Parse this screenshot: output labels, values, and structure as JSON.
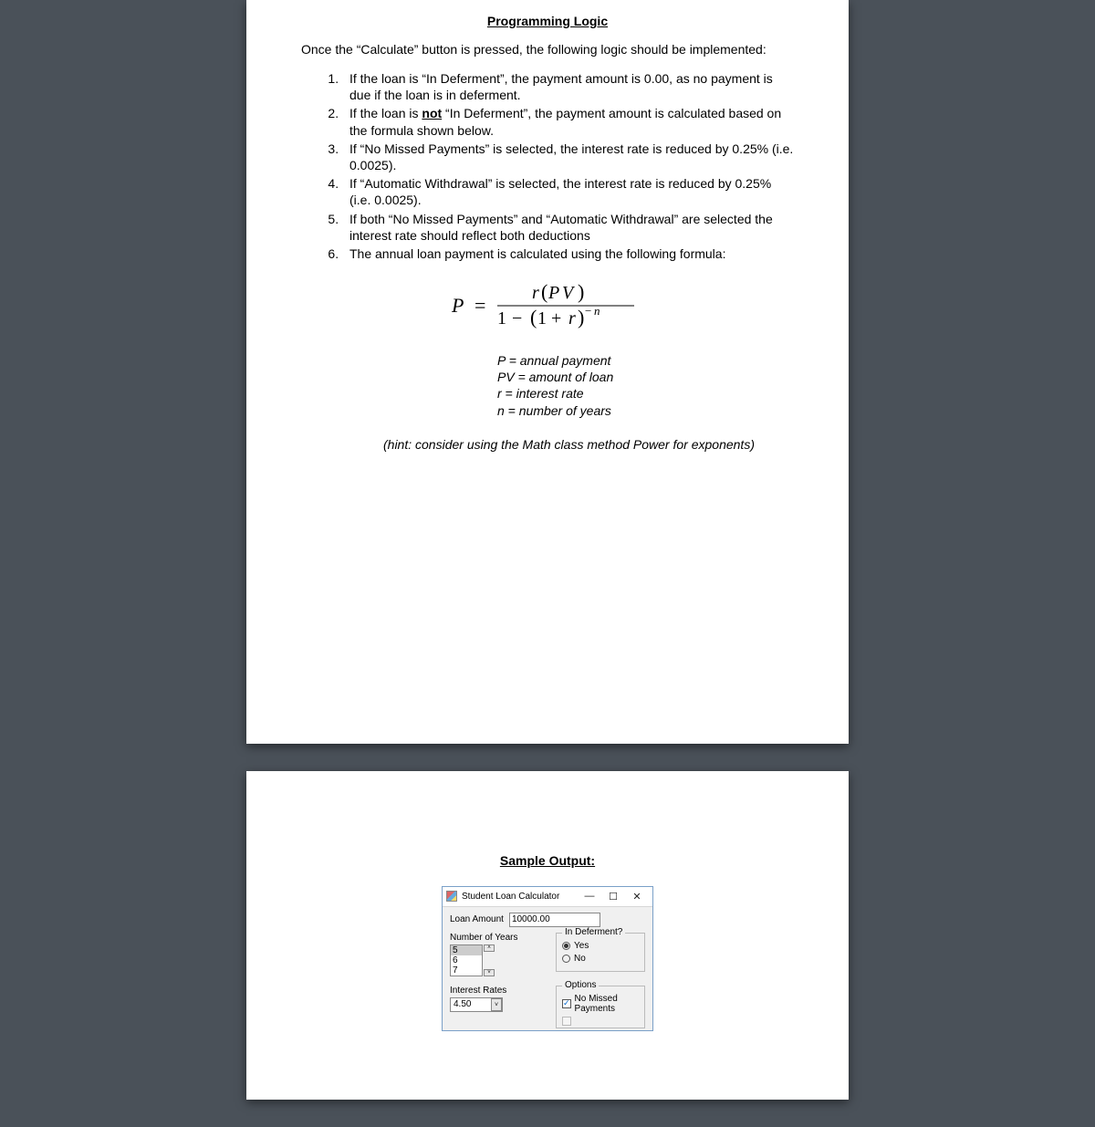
{
  "section1": {
    "title": "Programming Logic",
    "intro": "Once the “Calculate” button is pressed, the following logic should be implemented:",
    "rules": [
      "If the loan is “In Deferment”, the payment amount is 0.00, as no payment is due if the loan is in deferment.",
      "If the loan is __NOT__ “In Deferment”, the payment amount is calculated based on the formula shown below.",
      "If “No Missed Payments” is selected, the interest rate is reduced by 0.25% (i.e. 0.0025).",
      "If “Automatic Withdrawal” is selected, the interest rate is reduced by 0.25% (i.e. 0.0025).",
      "If both “No Missed Payments” and “Automatic Withdrawal” are selected the interest rate should reflect both deductions",
      "The annual loan payment is calculated using the following formula:"
    ],
    "legend": {
      "p": "P = annual payment",
      "pv": "PV = amount of loan",
      "r": "r = interest rate",
      "n": "n = number of years"
    },
    "hint": "(hint: consider using the Math class method Power for exponents)",
    "formula": "P = r(PV) / (1 − (1 + r)^−n)"
  },
  "section2": {
    "title": "Sample Output:",
    "window": {
      "title": "Student Loan Calculator",
      "loanAmountLabel": "Loan Amount",
      "loanAmountValue": "10000.00",
      "yearsLabel": "Number of Years",
      "yearsOptions": [
        "5",
        "6",
        "7"
      ],
      "yearsSelected": "5",
      "defermentTitle": "In Deferment?",
      "defermentYes": "Yes",
      "defermentNo": "No",
      "interestLabel": "Interest Rates",
      "interestValue": "4.50",
      "optionsTitle": "Options",
      "optNoMissed": "No Missed Payments"
    }
  }
}
